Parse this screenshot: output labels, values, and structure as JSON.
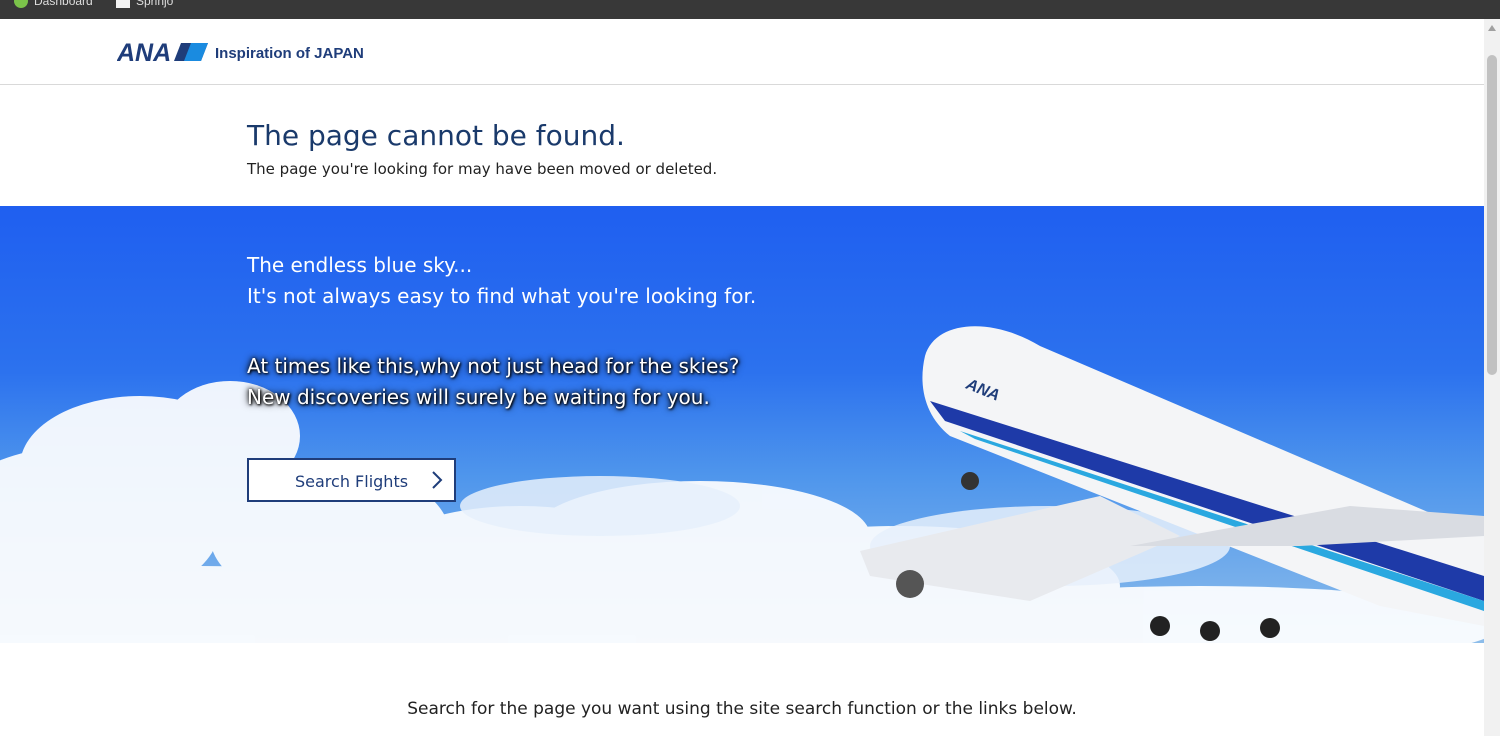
{
  "bookmarks": [
    {
      "label": "Dashboard",
      "icon": "dashboard-icon"
    },
    {
      "label": "Sprinjo",
      "icon": "page-icon"
    }
  ],
  "header": {
    "logo_text": "ANA",
    "tagline": "Inspiration of JAPAN",
    "brand_color": "#1f3d7a"
  },
  "error": {
    "title": "The page cannot be found.",
    "subtitle": "The page you're looking for may have been moved or deleted."
  },
  "hero": {
    "line1": "The endless blue sky...",
    "line2": "It's not always easy to find what you're looking for.",
    "line3": "At times like this,why not just head for the skies?",
    "line4": "New discoveries will surely be waiting for you.",
    "button_label": "Search Flights"
  },
  "footer": {
    "text": "Search for the page you want using the site search function or the links below."
  }
}
